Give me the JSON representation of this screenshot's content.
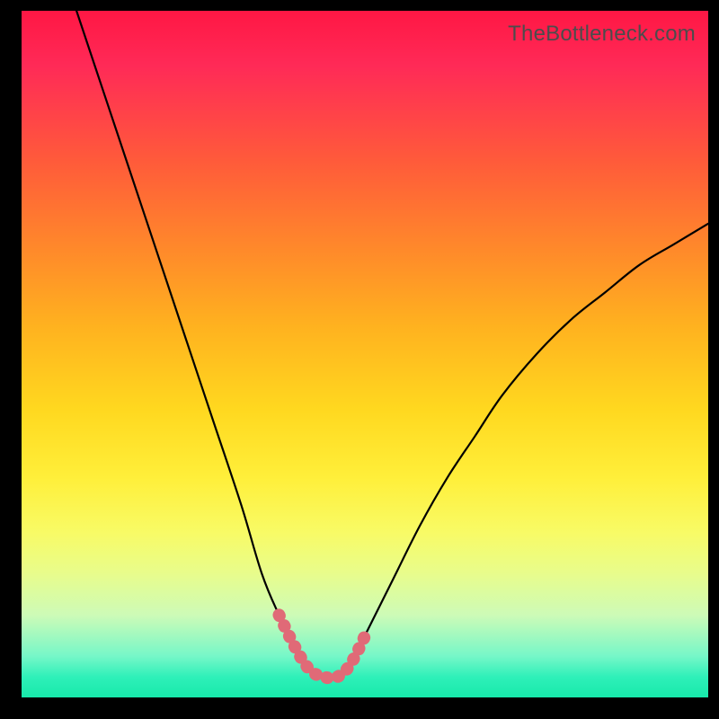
{
  "watermark": "TheBottleneck.com",
  "chart_data": {
    "type": "line",
    "title": "",
    "xlabel": "",
    "ylabel": "",
    "xlim": [
      0,
      100
    ],
    "ylim": [
      0,
      100
    ],
    "series": [
      {
        "name": "bottleneck-curve",
        "x": [
          8,
          12,
          16,
          20,
          24,
          28,
          32,
          35,
          37.5,
          40,
          42,
          44,
          46,
          48,
          50,
          54,
          58,
          62,
          66,
          70,
          75,
          80,
          85,
          90,
          95,
          100
        ],
        "y": [
          100,
          88,
          76,
          64,
          52,
          40,
          28,
          18,
          12,
          7,
          4,
          3,
          3,
          5,
          9,
          17,
          25,
          32,
          38,
          44,
          50,
          55,
          59,
          63,
          66,
          69
        ]
      },
      {
        "name": "highlight-segment",
        "x": [
          37.5,
          40,
          42,
          44,
          46,
          48,
          50.5
        ],
        "y": [
          12,
          7,
          4,
          3,
          3,
          5,
          10
        ]
      }
    ],
    "colors": {
      "curve": "#000000",
      "highlight": "#e06a77",
      "gradient_top": "#ff1744",
      "gradient_bottom": "#17e9aa"
    }
  }
}
